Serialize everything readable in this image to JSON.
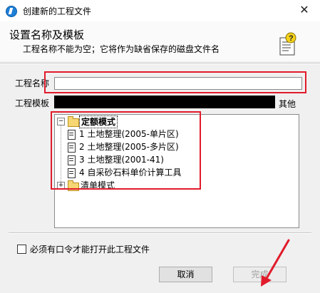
{
  "window": {
    "title": "创建新的工程文件",
    "close_glyph": "✕"
  },
  "header": {
    "heading": "设置名称及模板",
    "subheading": "工程名称不能为空；它将作为缺省保存的磁盘文件名",
    "icon": "wizard-help-icon"
  },
  "form": {
    "name_label": "工程名称",
    "name_value": "",
    "template_label": "工程模板",
    "template_value": "",
    "other_label": "其他"
  },
  "tree": {
    "groups": [
      {
        "label": "定额模式",
        "expander": "−",
        "items": [
          "1 土地整理(2005-单片区)",
          "2 土地整理(2005-多片区)",
          "3 土地整理(2001-41)",
          "4 自采砂石料单价计算工具"
        ]
      },
      {
        "label": "清单模式",
        "expander": "+",
        "items": []
      }
    ]
  },
  "options": {
    "password_label": "必须有口令才能打开此工程文件",
    "password_checked": false
  },
  "buttons": {
    "cancel": "取消",
    "finish": "完成"
  },
  "colors": {
    "annotation": "#e11b2b",
    "folder": "#f7d774",
    "disabled_text": "#a0a0a0"
  }
}
